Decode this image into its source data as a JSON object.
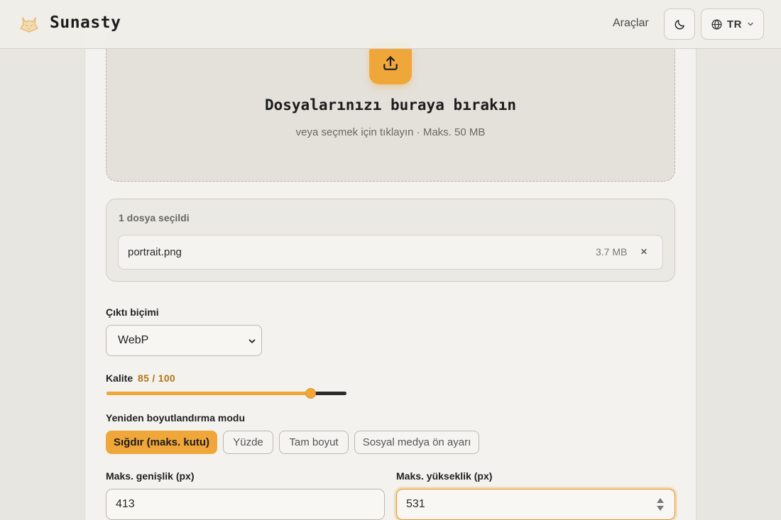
{
  "header": {
    "brand": "Sunasty",
    "nav_tools": "Araçlar",
    "language_code": "TR"
  },
  "dropzone": {
    "title": "Dosyalarınızı buraya bırakın",
    "subtitle": "veya seçmek için tıklayın · Maks. 50 MB"
  },
  "files": {
    "count_label": "1 dosya seçildi",
    "items": [
      {
        "name": "portrait.png",
        "size": "3.7 MB",
        "remove": "×"
      }
    ]
  },
  "form": {
    "output_format": {
      "label": "Çıktı biçimi",
      "selected": "WebP"
    },
    "quality": {
      "label": "Kalite",
      "display": "85 / 100",
      "value": 85,
      "max": 100
    },
    "resize_mode": {
      "label": "Yeniden boyutlandırma modu",
      "options": [
        {
          "label": "Sığdır (maks. kutu)",
          "active": true
        },
        {
          "label": "Yüzde",
          "active": false
        },
        {
          "label": "Tam boyut",
          "active": false
        },
        {
          "label": "Sosyal medya ön ayarı",
          "active": false
        }
      ]
    },
    "max_width": {
      "label": "Maks. genişlik (px)",
      "value": "413"
    },
    "max_height": {
      "label": "Maks. yükseklik (px)",
      "value": "531"
    }
  },
  "colors": {
    "accent": "#f0a73a",
    "accent_text": "#b57416",
    "background": "#e8e6e1"
  },
  "icons": {
    "logo": "fox-logo-icon",
    "theme": "moon-icon",
    "language": "globe-icon",
    "language_menu": "chevron-down-icon",
    "upload": "upload-icon",
    "remove_file": "close-icon",
    "select_caret": "chevron-down-icon",
    "number_spinner": "spinner-arrows-icon"
  }
}
